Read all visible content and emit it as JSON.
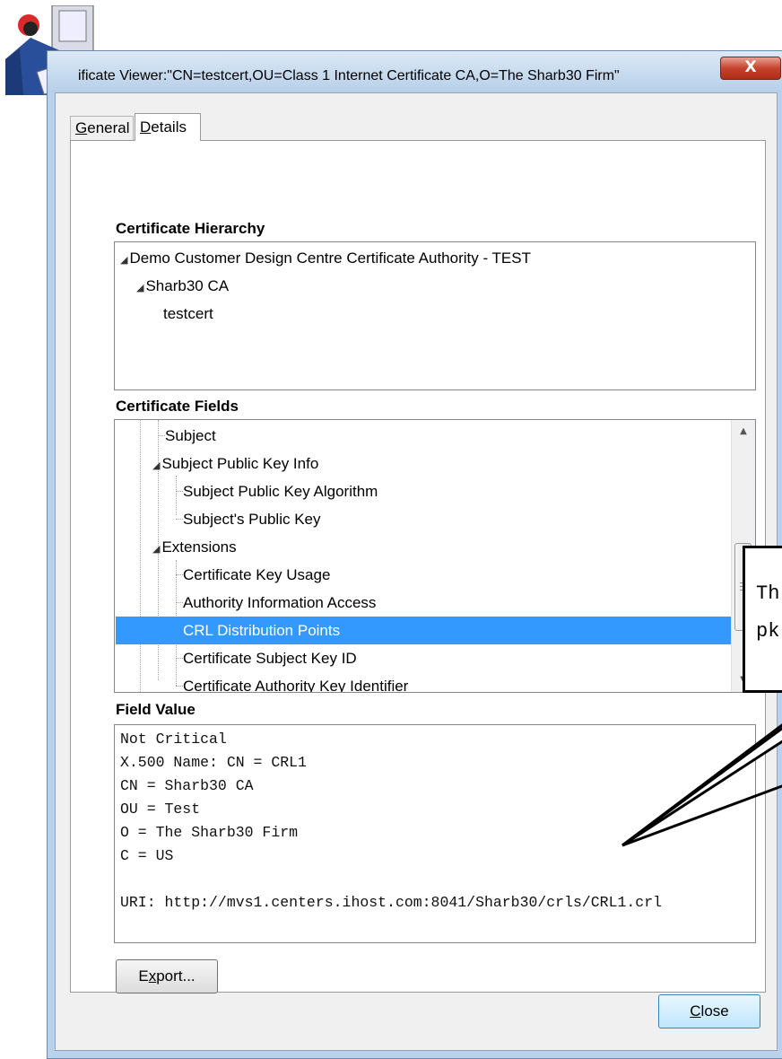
{
  "window": {
    "title": "ificate Viewer:\"CN=testcert,OU=Class 1 Internet Certificate CA,O=The Sharb30 Firm\"",
    "close_glyph": "X"
  },
  "tabs": [
    {
      "label_prefix": "",
      "accel": "G",
      "label_rest": "eneral"
    },
    {
      "label_prefix": "",
      "accel": "D",
      "label_rest": "etails"
    }
  ],
  "hierarchy": {
    "heading": "Certificate Hierarchy",
    "items": [
      "Demo Customer Design Centre Certificate Authority - TEST",
      "Sharb30 CA",
      "testcert"
    ]
  },
  "fields": {
    "heading": "Certificate Fields",
    "rows": [
      "Subject",
      "Subject Public Key Info",
      "Subject Public Key Algorithm",
      "Subject's Public Key",
      "Extensions",
      "Certificate Key Usage",
      "Authority Information Access",
      "CRL Distribution Points",
      "Certificate Subject Key ID",
      "Certificate Authority Key Identifier"
    ],
    "selected_index": 7
  },
  "field_value": {
    "heading": "Field Value",
    "lines": [
      "Not Critical",
      "X.500 Name: CN = CRL1",
      "CN = Sharb30 CA",
      "OU = Test",
      "O = The Sharb30 Firm",
      "C = US",
      "",
      "URI: http://mvs1.centers.ihost.com:8041/Sharb30/crls/CRL1.crl"
    ]
  },
  "buttons": {
    "export_accel": "x",
    "export_pre": "E",
    "export_post": "port...",
    "close_accel": "C",
    "close_rest": "lose"
  },
  "callout": {
    "lines": [
      "Th",
      "pk"
    ]
  },
  "icons": {
    "window_icon": "user-at-computer-icon",
    "expand": "triangle-expanded-icon",
    "scroll_up": "scroll-up-arrow-icon",
    "scroll_down": "scroll-down-arrow-icon"
  },
  "colors": {
    "selection": "#3399ff",
    "title_close": "#c7432f"
  }
}
